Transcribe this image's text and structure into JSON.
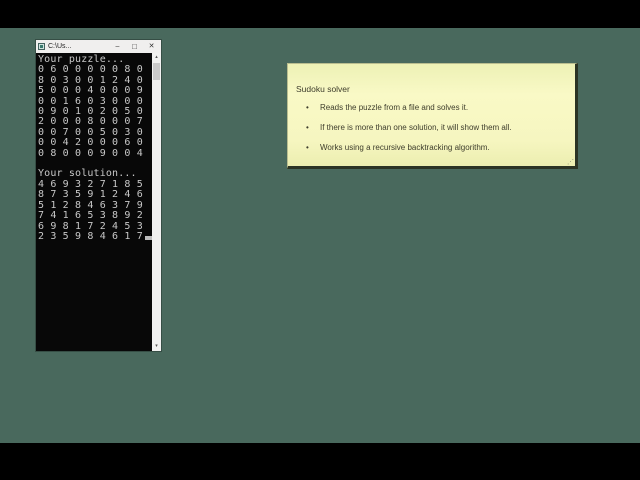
{
  "window": {
    "title": "C:\\Us...",
    "controls": {
      "minimize": "–",
      "maximize": "□",
      "close": "✕"
    },
    "scrollbar": {
      "up": "▴",
      "down": "▾"
    },
    "lines": [
      "Your puzzle...",
      "0 6 0 0 0 0 0 8 0",
      "8 0 3 0 0 1 2 4 0",
      "5 0 0 0 4 0 0 0 9",
      "0 0 1 6 0 3 0 0 0",
      "0 9 0 1 0 2 0 5 0",
      "2 0 0 0 8 0 0 0 7",
      "0 0 7 0 0 5 0 3 0",
      "0 0 4 2 0 0 0 6 0",
      "0 8 0 0 0 9 0 0 4",
      "",
      "Your solution...",
      "4 6 9 3 2 7 1 8 5",
      "8 7 3 5 9 1 2 4 6",
      "5 1 2 8 4 6 3 7 9",
      "7 4 1 6 5 3 8 9 2",
      "6 9 8 1 7 2 4 5 3",
      "2 3 5 9 8 4 6 1 7"
    ]
  },
  "note": {
    "title": "Sudoku solver",
    "bullet_char": "•",
    "bullets": [
      "Reads the puzzle from a file and solves it.",
      "If there is more than one solution, it will show them all.",
      "Works using a recursive backtracking algorithm."
    ],
    "resize_grip": "⋰"
  },
  "colors": {
    "letterbox": "#000000",
    "desktop": "#49695d",
    "console_bg": "#080808",
    "console_text": "#c8c8c8",
    "titlebar_bg": "#f0efee",
    "note_bg_top": "#edf1b5",
    "note_bg_mid": "#f9f9c6",
    "note_shadow": "#2b3424",
    "note_text": "#3e3d2c"
  }
}
